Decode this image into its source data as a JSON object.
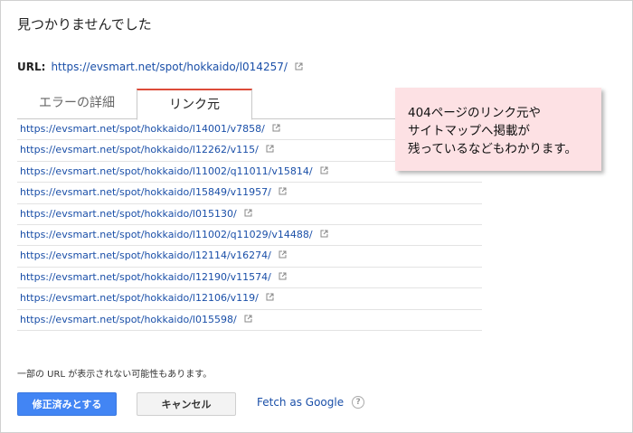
{
  "page": {
    "title": "見つかりませんでした"
  },
  "url_row": {
    "label": "URL:",
    "value": "https://evsmart.net/spot/hokkaido/l014257/",
    "icon": "external-link-icon"
  },
  "tabs": [
    {
      "label": "エラーの詳細",
      "active": false
    },
    {
      "label": "リンク元",
      "active": true
    }
  ],
  "links": [
    "https://evsmart.net/spot/hokkaido/l14001/v7858/",
    "https://evsmart.net/spot/hokkaido/l12262/v115/",
    "https://evsmart.net/spot/hokkaido/l11002/q11011/v15814/",
    "https://evsmart.net/spot/hokkaido/l15849/v11957/",
    "https://evsmart.net/spot/hokkaido/l015130/",
    "https://evsmart.net/spot/hokkaido/l11002/q11029/v14488/",
    "https://evsmart.net/spot/hokkaido/l12114/v16274/",
    "https://evsmart.net/spot/hokkaido/l12190/v11574/",
    "https://evsmart.net/spot/hokkaido/l12106/v119/",
    "https://evsmart.net/spot/hokkaido/l015598/"
  ],
  "note": {
    "lines": [
      "404ページのリンク元や",
      "サイトマップへ掲載が",
      "残っているなどもわかります。"
    ],
    "background": "#fde1e4"
  },
  "footnote": "一部の URL が表示されない可能性もあります。",
  "actions": {
    "primary_label": "修正済みとする",
    "cancel_label": "キャンセル",
    "fetch_label": "Fetch as Google",
    "help_icon": "question-circle-icon"
  },
  "colors": {
    "link": "#1a4fa8",
    "primary_button": "#4285f4",
    "active_tab_accent": "#dd4b39"
  }
}
